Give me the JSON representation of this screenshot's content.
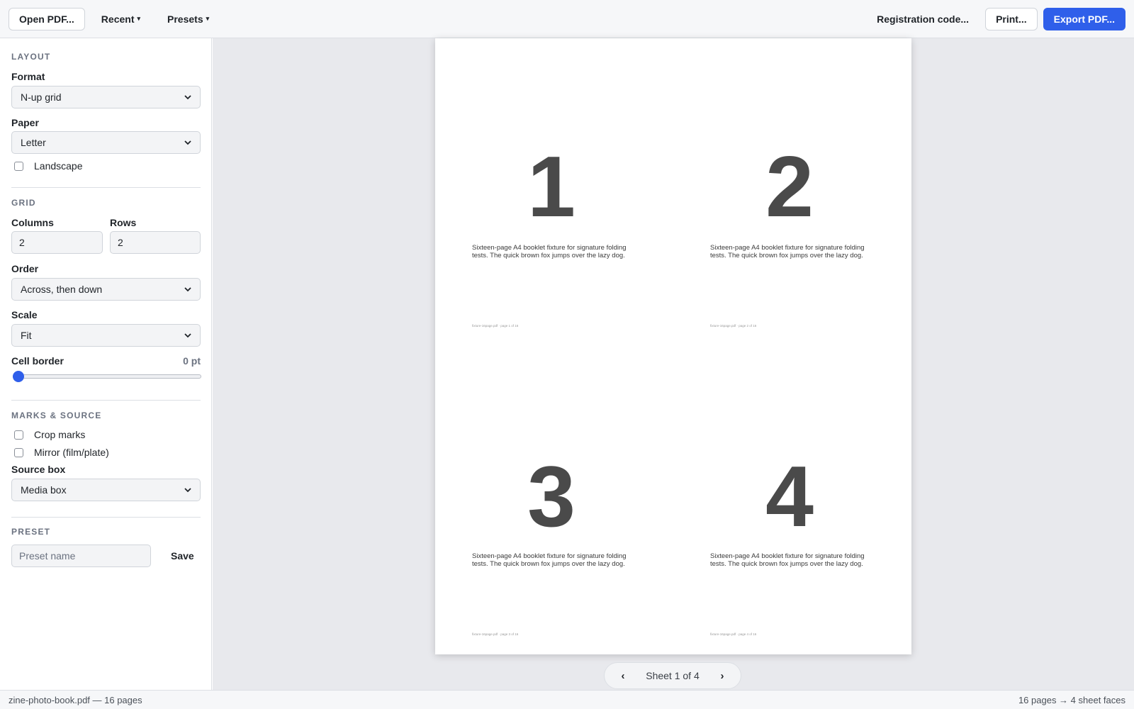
{
  "toolbar": {
    "open_label": "Open PDF...",
    "recent_label": "Recent",
    "presets_label": "Presets",
    "caret": "▾",
    "registration_label": "Registration code...",
    "print_label": "Print...",
    "export_label": "Export PDF..."
  },
  "sidebar": {
    "layout": {
      "title": "LAYOUT",
      "format_label": "Format",
      "format_value": "N-up grid",
      "paper_label": "Paper",
      "paper_value": "Letter",
      "landscape_label": "Landscape",
      "landscape_checked": false
    },
    "grid": {
      "title": "GRID",
      "columns_label": "Columns",
      "columns_value": "2",
      "rows_label": "Rows",
      "rows_value": "2",
      "order_label": "Order",
      "order_value": "Across, then down",
      "scale_label": "Scale",
      "scale_value": "Fit",
      "cell_border_label": "Cell border",
      "cell_border_value": "0 pt",
      "cell_border_fraction": 0
    },
    "marks": {
      "title": "MARKS & SOURCE",
      "crop_marks_label": "Crop marks",
      "crop_marks_checked": false,
      "mirror_label": "Mirror (film/plate)",
      "mirror_checked": false,
      "source_box_label": "Source box",
      "source_box_value": "Media box"
    },
    "preset": {
      "title": "PRESET",
      "name_placeholder": "Preset name",
      "save_label": "Save"
    }
  },
  "preview": {
    "cells": [
      {
        "number": "1",
        "text": "Sixteen-page A4 booklet fixture for signature folding tests. The quick brown fox jumps over the lazy dog.",
        "footer": "fixture-16page.pdf · page 1 of 16"
      },
      {
        "number": "2",
        "text": "Sixteen-page A4 booklet fixture for signature folding tests. The quick brown fox jumps over the lazy dog.",
        "footer": "fixture-16page.pdf · page 2 of 16"
      },
      {
        "number": "3",
        "text": "Sixteen-page A4 booklet fixture for signature folding tests. The quick brown fox jumps over the lazy dog.",
        "footer": "fixture-16page.pdf · page 3 of 16"
      },
      {
        "number": "4",
        "text": "Sixteen-page A4 booklet fixture for signature folding tests. The quick brown fox jumps over the lazy dog.",
        "footer": "fixture-16page.pdf · page 4 of 16"
      }
    ],
    "pager": {
      "prev": "‹",
      "label": "Sheet 1 of 4",
      "next": "›"
    }
  },
  "status": {
    "left": "zine-photo-book.pdf — 16 pages",
    "right": "16 pages → 4 sheet faces"
  },
  "colors": {
    "accent": "#2f5fea",
    "canvas_bg": "#e8e9ed"
  }
}
